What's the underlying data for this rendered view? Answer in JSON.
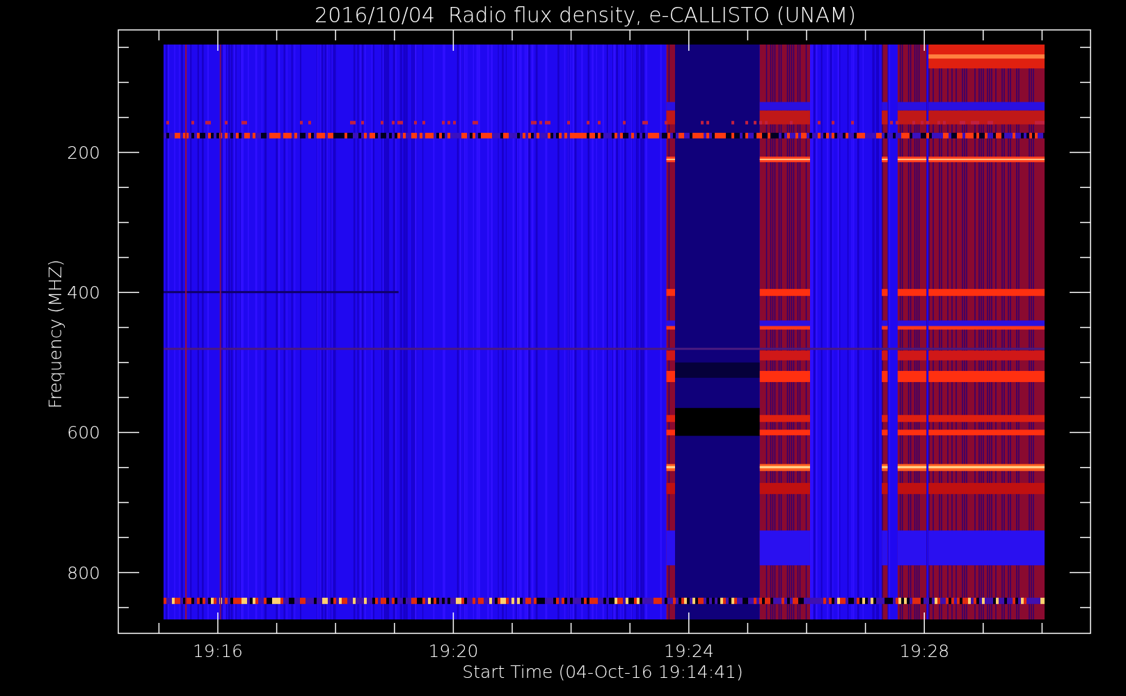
{
  "title": "2016/10/04  Radio flux density, e-CALLISTO (UNAM)",
  "y_axis": {
    "label": "Frequency (MHZ)",
    "ticks": [
      "200",
      "400",
      "600",
      "800"
    ]
  },
  "x_axis": {
    "label": "Start Time (04-Oct-16 19:14:41)",
    "ticks": [
      "19:16",
      "19:20",
      "19:24",
      "19:28"
    ]
  }
}
